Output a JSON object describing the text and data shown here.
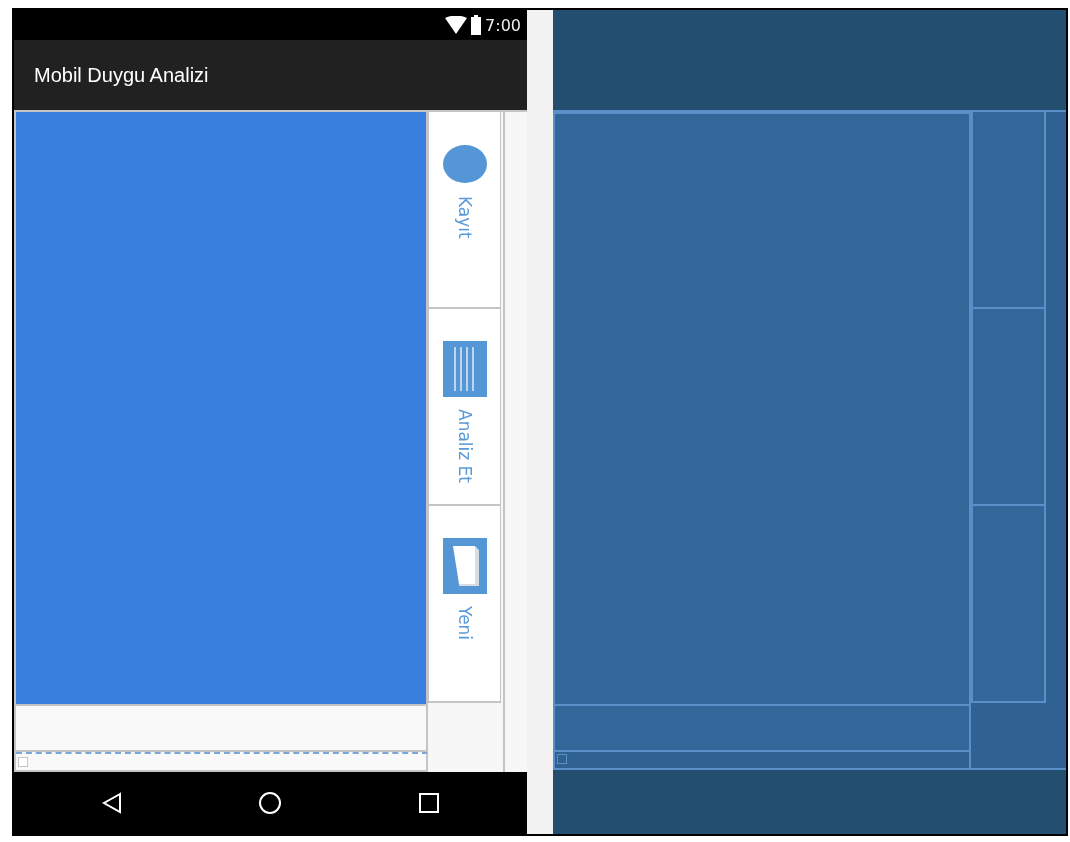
{
  "status_bar": {
    "time": "7:00"
  },
  "app_bar": {
    "title": "Mobil Duygu Analizi"
  },
  "side_buttons": [
    {
      "kind": "record",
      "label": "Kayıt"
    },
    {
      "kind": "analyze",
      "label": "Analiz Et"
    },
    {
      "kind": "new",
      "label": "Yeni"
    }
  ]
}
